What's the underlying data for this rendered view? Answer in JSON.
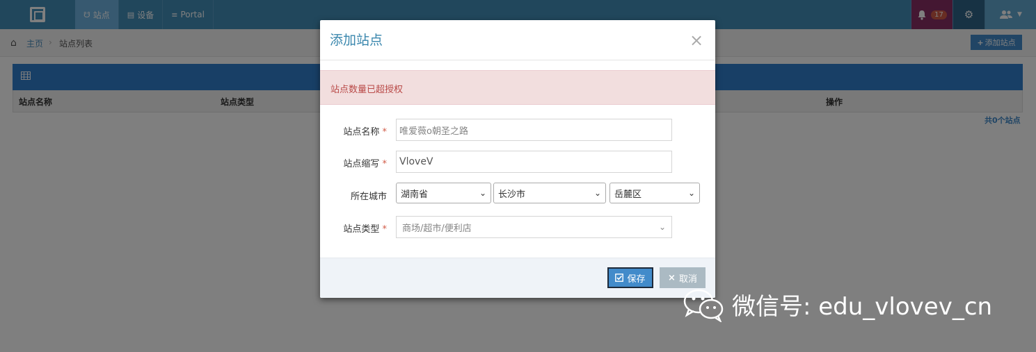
{
  "navbar": {
    "tabs": [
      {
        "label": "站点",
        "icon": "plug-icon",
        "active": true
      },
      {
        "label": "设备",
        "icon": "hdd-icon",
        "active": false
      },
      {
        "label": "Portal",
        "icon": "sliders-icon",
        "active": false
      }
    ],
    "notification_count": "17",
    "colors": {
      "bar": "#438eb9",
      "active_tab": "#6fb3e0",
      "bell_bg": "#892e65",
      "gear_bg": "#2e6589",
      "user_bg": "#62a8d1"
    }
  },
  "breadcrumb": {
    "home": "主页",
    "current": "站点列表"
  },
  "toolbar": {
    "add_site_label": "添加站点"
  },
  "table": {
    "columns": [
      "站点名称",
      "站点类型",
      "操作"
    ],
    "count_text": "共0个站点"
  },
  "modal": {
    "title": "添加站点",
    "alert": "站点数量已超授权",
    "fields": {
      "name_label": "站点名称",
      "name_placeholder": "唯爱薇o朝圣之路",
      "abbr_label": "站点缩写",
      "abbr_value": "VloveV",
      "city_label": "所在城市",
      "province": "湖南省",
      "city": "长沙市",
      "district": "岳麓区",
      "type_label": "站点类型",
      "type_value": "商场/超市/便利店"
    },
    "save_label": "保存",
    "cancel_label": "取消"
  },
  "watermark": {
    "text": "微信号: edu_vlovev_cn"
  }
}
